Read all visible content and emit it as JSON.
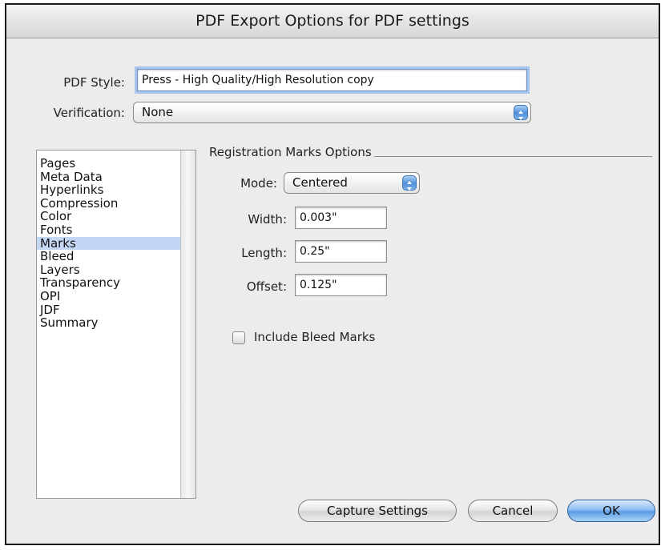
{
  "window": {
    "title": "PDF Export Options for PDF settings"
  },
  "pdf_style": {
    "label": "PDF Style:",
    "value": "Press - High Quality/High Resolution copy"
  },
  "verification": {
    "label": "Verification:",
    "value": "None"
  },
  "sidebar": {
    "items": [
      "Pages",
      "Meta Data",
      "Hyperlinks",
      "Compression",
      "Color",
      "Fonts",
      "Marks",
      "Bleed",
      "Layers",
      "Transparency",
      "OPI",
      "JDF",
      "Summary"
    ],
    "selected": "Marks"
  },
  "marks": {
    "group_title": "Registration Marks Options",
    "mode_label": "Mode:",
    "mode_value": "Centered",
    "width_label": "Width:",
    "width_value": "0.003\"",
    "length_label": "Length:",
    "length_value": "0.25\"",
    "offset_label": "Offset:",
    "offset_value": "0.125\"",
    "bleed_marks_label": "Include Bleed Marks",
    "bleed_marks_checked": false
  },
  "buttons": {
    "capture": "Capture Settings",
    "cancel": "Cancel",
    "ok": "OK"
  },
  "colors": {
    "focus_ring": "#a9c4ea",
    "selection": "#c3d6f4",
    "default_button": "#5b9be3"
  },
  "icons": {
    "popup_arrows": "updown-chevron-icon"
  }
}
